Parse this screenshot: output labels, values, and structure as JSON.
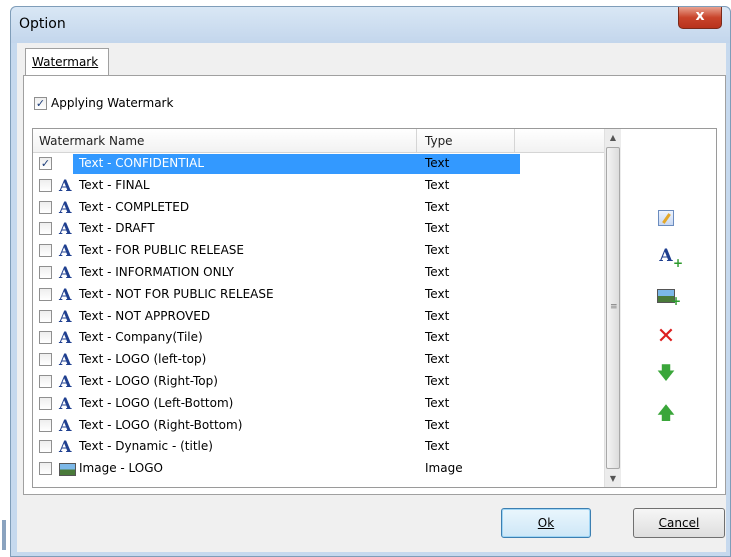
{
  "window": {
    "title": "Option",
    "close_label": "x"
  },
  "tabs": [
    {
      "label": "Watermark",
      "active": true
    }
  ],
  "apply": {
    "label": "Applying Watermark",
    "checked_glyph": "✓"
  },
  "list": {
    "columns": {
      "name": "Watermark Name",
      "type": "Type"
    },
    "rows": [
      {
        "name": "Text - CONFIDENTIAL",
        "type": "Text",
        "icon": "text-a-icon",
        "checked": "✓",
        "selected": true
      },
      {
        "name": "Text - FINAL",
        "type": "Text",
        "icon": "text-a-icon",
        "checked": ""
      },
      {
        "name": "Text - COMPLETED",
        "type": "Text",
        "icon": "text-a-icon",
        "checked": ""
      },
      {
        "name": "Text - DRAFT",
        "type": "Text",
        "icon": "text-a-icon",
        "checked": ""
      },
      {
        "name": "Text - FOR PUBLIC RELEASE",
        "type": "Text",
        "icon": "text-a-icon",
        "checked": ""
      },
      {
        "name": "Text - INFORMATION ONLY",
        "type": "Text",
        "icon": "text-a-icon",
        "checked": ""
      },
      {
        "name": "Text - NOT FOR PUBLIC RELEASE",
        "type": "Text",
        "icon": "text-a-icon",
        "checked": ""
      },
      {
        "name": "Text - NOT APPROVED",
        "type": "Text",
        "icon": "text-a-icon",
        "checked": ""
      },
      {
        "name": "Text - Company(Tile)",
        "type": "Text",
        "icon": "text-a-icon",
        "checked": ""
      },
      {
        "name": "Text - LOGO (left-top)",
        "type": "Text",
        "icon": "text-a-icon",
        "checked": ""
      },
      {
        "name": "Text - LOGO (Right-Top)",
        "type": "Text",
        "icon": "text-a-icon",
        "checked": ""
      },
      {
        "name": "Text - LOGO (Left-Bottom)",
        "type": "Text",
        "icon": "text-a-icon",
        "checked": ""
      },
      {
        "name": "Text - LOGO (Right-Bottom)",
        "type": "Text",
        "icon": "text-a-icon",
        "checked": ""
      },
      {
        "name": "Text - Dynamic - (title)",
        "type": "Text",
        "icon": "text-a-icon",
        "checked": ""
      },
      {
        "name": "Image - LOGO",
        "type": "Image",
        "icon": "image-icon",
        "checked": ""
      }
    ]
  },
  "tools": [
    {
      "icon": "edit-icon"
    },
    {
      "icon": "add-text-icon"
    },
    {
      "icon": "add-image-icon"
    },
    {
      "icon": "delete-icon"
    },
    {
      "icon": "move-down-icon"
    },
    {
      "icon": "move-up-icon"
    }
  ],
  "buttons": {
    "ok": "Ok",
    "cancel": "Cancel"
  },
  "colors": {
    "selection": "#3399ff",
    "delete": "#dd1f1f",
    "arrows": "#3aa63a",
    "titlebar": "#c6d9ee"
  }
}
